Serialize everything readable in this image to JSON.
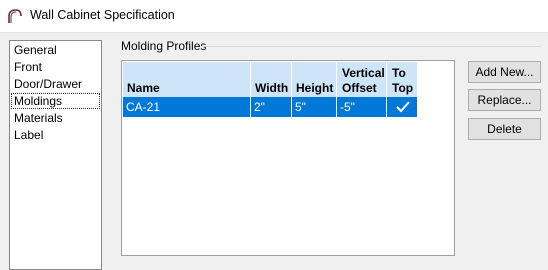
{
  "window": {
    "title": "Wall Cabinet Specification",
    "icon": "cabinet-arch-icon"
  },
  "sidebar": {
    "items": [
      {
        "label": "General"
      },
      {
        "label": "Front"
      },
      {
        "label": "Door/Drawer"
      },
      {
        "label": "Moldings",
        "selected": true
      },
      {
        "label": "Materials"
      },
      {
        "label": "Label"
      }
    ]
  },
  "moldings": {
    "group_label": "Molding Profiles",
    "table": {
      "headers": {
        "name": "Name",
        "width": "Width",
        "height": "Height",
        "offset_line1": "Vertical",
        "offset_line2": "Offset",
        "totop_line1": "To",
        "totop_line2": "Top"
      },
      "rows": [
        {
          "name": "CA-21",
          "width": "2\"",
          "height": "5\"",
          "vertical_offset": "-5\"",
          "to_top": true
        }
      ]
    }
  },
  "buttons": {
    "add_new": "Add New...",
    "replace": "Replace...",
    "delete": "Delete"
  },
  "colors": {
    "selection": "#0078d7",
    "header": "#cde5f7"
  }
}
